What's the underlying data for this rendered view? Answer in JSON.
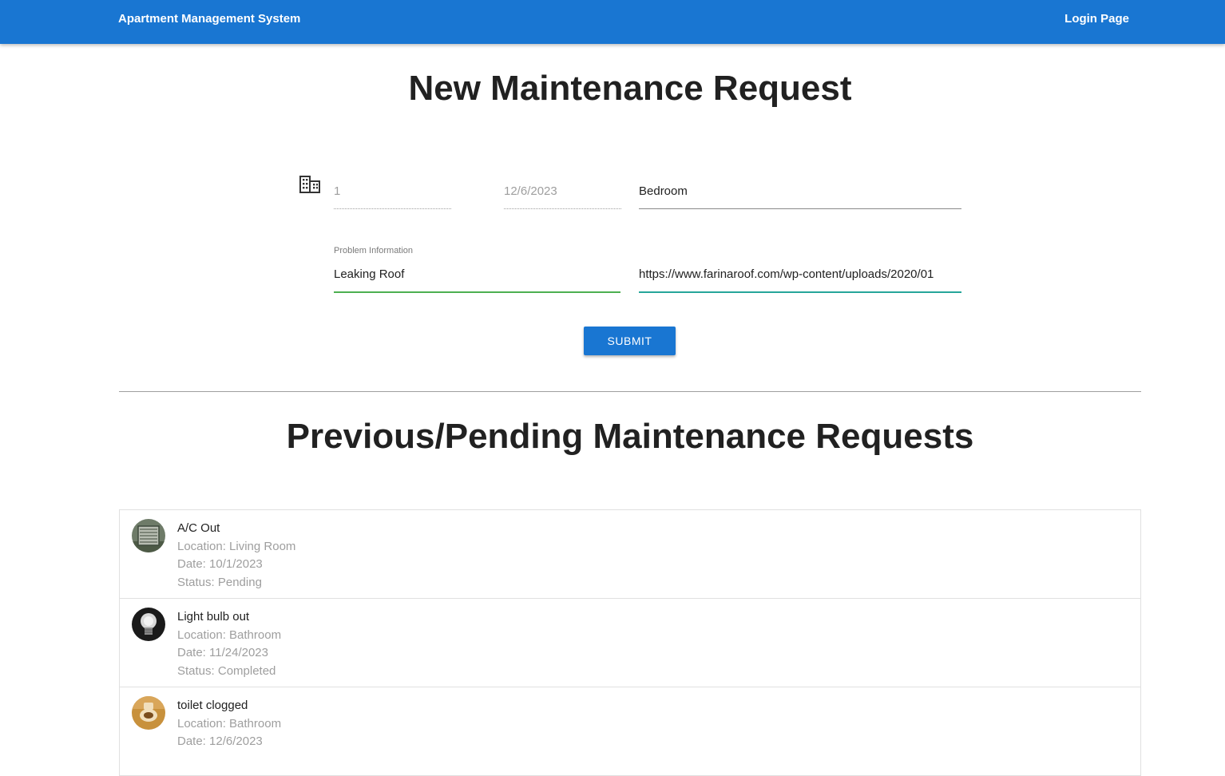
{
  "app": {
    "title": "Apartment Management System",
    "login_link": "Login Page"
  },
  "new_request": {
    "heading": "New Maintenance Request",
    "apartment_field": {
      "value": "1"
    },
    "date_field": {
      "value": "12/6/2023"
    },
    "location_field": {
      "value": "Bedroom"
    },
    "problem_field": {
      "label": "Problem Information",
      "value": "Leaking Roof"
    },
    "image_url_field": {
      "value": "https://www.farinaroof.com/wp-content/uploads/2020/01"
    },
    "submit_label": "SUBMIT"
  },
  "previous": {
    "heading": "Previous/Pending Maintenance Requests",
    "items": [
      {
        "title": "A/C Out",
        "location": "Location: Living Room",
        "date": "Date: 10/1/2023",
        "status": "Status: Pending",
        "avatar_icon": "air-conditioner-photo",
        "avatar_colors": [
          "#6e7b68",
          "#3f4a3c",
          "#b8bdb2"
        ]
      },
      {
        "title": "Light bulb out",
        "location": "Location: Bathroom",
        "date": "Date: 11/24/2023",
        "status": "Status: Completed",
        "avatar_icon": "light-bulb-photo",
        "avatar_colors": [
          "#1a1a1a",
          "#d8d8d8",
          "#8a8a8a"
        ]
      },
      {
        "title": "toilet clogged",
        "location": "Location: Bathroom",
        "date": "Date: 12/6/2023",
        "status": "",
        "avatar_icon": "toilet-photo",
        "avatar_colors": [
          "#c8913c",
          "#f1dfbd",
          "#7a4d1e"
        ]
      }
    ]
  },
  "colors": {
    "primary": "#1976d2",
    "valid_green": "#4caf50",
    "valid_teal": "#26a69a"
  }
}
